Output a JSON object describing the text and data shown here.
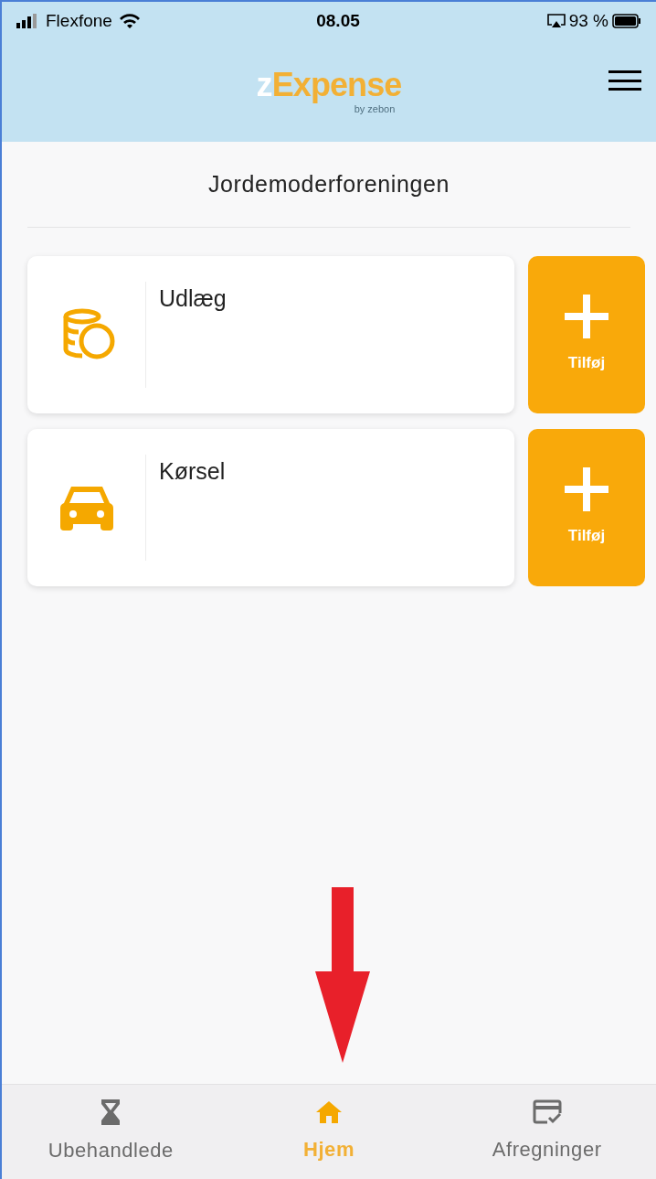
{
  "status_bar": {
    "carrier": "Flexfone",
    "time": "08.05",
    "battery": "93 %"
  },
  "header": {
    "logo_prefix": "z",
    "logo_main": "Expense",
    "logo_byline": "by zebon"
  },
  "page_title": "Jordemoderforeningen",
  "cards": [
    {
      "kind": "expense",
      "label": "Udlæg",
      "action": "Tilføj"
    },
    {
      "kind": "mileage",
      "label": "Kørsel",
      "action": "Tilføj"
    }
  ],
  "bottom_nav": [
    {
      "kind": "pending",
      "label": "Ubehandlede",
      "selected": false
    },
    {
      "kind": "home",
      "label": "Hjem",
      "selected": true
    },
    {
      "kind": "settlements",
      "label": "Afregninger",
      "selected": false
    }
  ]
}
